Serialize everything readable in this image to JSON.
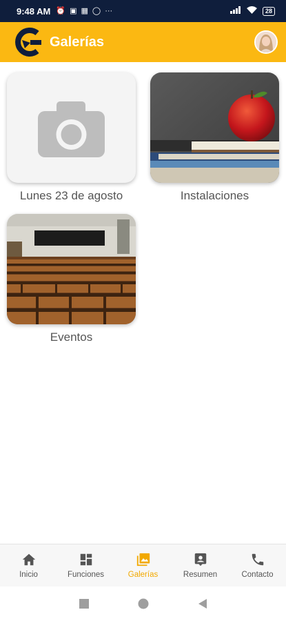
{
  "status_bar": {
    "time": "9:48 AM",
    "battery": "28"
  },
  "app_bar": {
    "title": "Galerías"
  },
  "gallery": {
    "items": [
      {
        "label": "Lunes 23 de agosto",
        "image": "camera-placeholder-icon"
      },
      {
        "label": "Instalaciones",
        "image": "apple-on-books-photo"
      },
      {
        "label": "Eventos",
        "image": "lecture-hall-photo"
      }
    ]
  },
  "bottom_nav": {
    "items": [
      {
        "label": "Inicio",
        "icon": "home-icon"
      },
      {
        "label": "Funciones",
        "icon": "dashboard-icon"
      },
      {
        "label": "Galerías",
        "icon": "gallery-icon",
        "active": true
      },
      {
        "label": "Resumen",
        "icon": "contact-card-icon"
      },
      {
        "label": "Contacto",
        "icon": "phone-icon"
      }
    ]
  },
  "colors": {
    "status_bar": "#0f1e3c",
    "app_bar": "#fbb812",
    "active_nav": "#f2a900",
    "logo_dark": "#0f1e3c"
  }
}
